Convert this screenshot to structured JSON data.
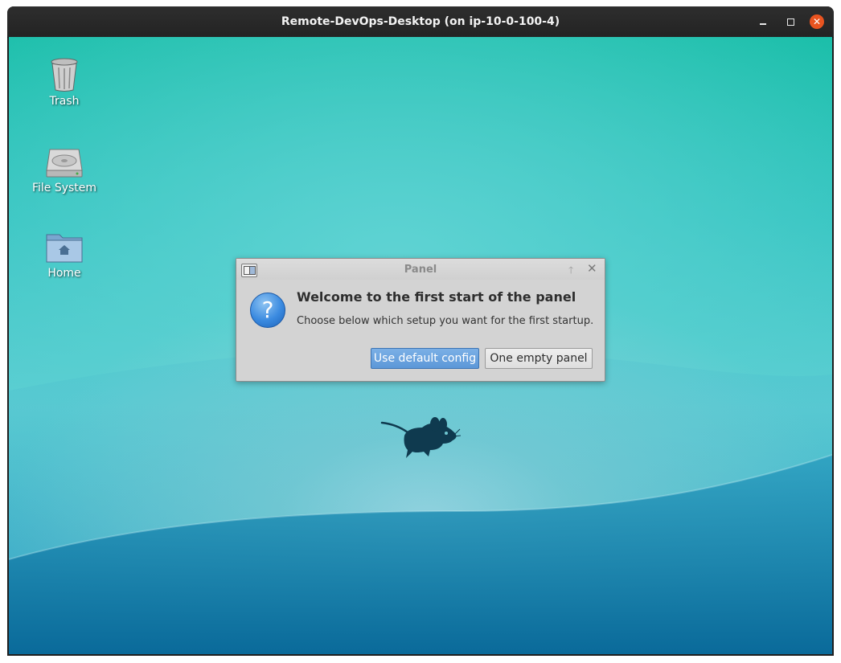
{
  "window": {
    "title": "Remote-DevOps-Desktop (on ip-10-0-100-4)",
    "controls": [
      "minimize-icon",
      "maximize-icon",
      "close-icon"
    ]
  },
  "desktop": {
    "icons": [
      {
        "label": "Trash",
        "icon": "trash-icon"
      },
      {
        "label": "File System",
        "icon": "hard-drive-icon"
      },
      {
        "label": "Home",
        "icon": "home-folder-icon"
      }
    ],
    "wallpaper_logo": "xfce-mouse-logo"
  },
  "dialog": {
    "title": "Panel",
    "heading": "Welcome to the first start of the panel",
    "message": "Choose below which setup you want for the first startup.",
    "buttons": {
      "default_label": "Use default config",
      "empty_label": "One empty panel"
    },
    "icon": "question-icon"
  },
  "colors": {
    "accent_close": "#e95420",
    "default_button": "#5c98d8"
  }
}
